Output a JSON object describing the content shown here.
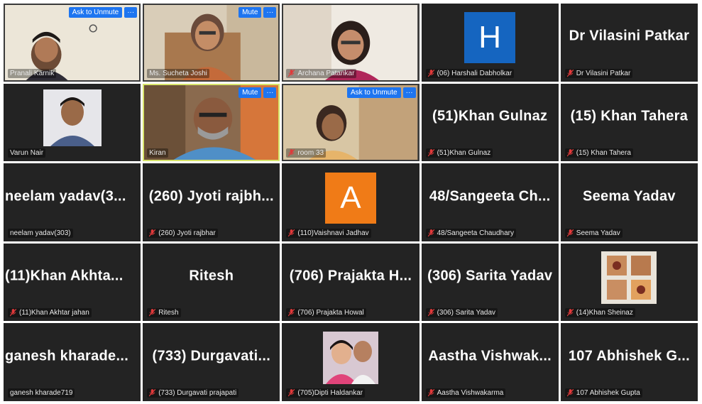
{
  "colors": {
    "tile_bg": "#232323",
    "button_blue": "#1e75f0",
    "active_border": "#d7e46a",
    "muted_red": "#e0393a",
    "avatar_H": "#1565c0",
    "avatar_A": "#f07b17"
  },
  "tiles": [
    {
      "label": "Pranali Karnik",
      "button": "Ask to Unmute",
      "more": "···"
    },
    {
      "label": "Ms. Sucheta Joshi",
      "button": "Mute",
      "more": "···"
    },
    {
      "label": "Archana Patankar"
    },
    {
      "label": "(06) Harshali Dabholkar",
      "avatar_letter": "H"
    },
    {
      "title": "Dr Vilasini Patkar",
      "label": "Dr Vilasini Patkar"
    },
    {
      "label": "Varun Nair"
    },
    {
      "label": "Kiran",
      "button": "Mute",
      "more": "···"
    },
    {
      "label": "room 33",
      "button": "Ask to Unmute",
      "more": "···"
    },
    {
      "title": "(51)Khan Gulnaz",
      "label": "(51)Khan Gulnaz"
    },
    {
      "title": "(15) Khan Tahera",
      "label": "(15) Khan Tahera"
    },
    {
      "title": "neelam yadav(3...",
      "label": "neelam yadav(303)"
    },
    {
      "title": "(260) Jyoti rajbh...",
      "label": "(260) Jyoti rajbhar"
    },
    {
      "label": "(110)Vaishnavi Jadhav",
      "avatar_letter": "A"
    },
    {
      "title": "48/Sangeeta Ch...",
      "label": "48/Sangeeta Chaudhary"
    },
    {
      "title": "Seema Yadav",
      "label": "Seema Yadav"
    },
    {
      "title": "(11)Khan Akhta...",
      "label": "(11)Khan Akhtar jahan"
    },
    {
      "title": "Ritesh",
      "label": "Ritesh"
    },
    {
      "title": "(706) Prajakta H...",
      "label": "(706) Prajakta Howal"
    },
    {
      "title": "(306) Sarita Yadav",
      "label": "(306) Sarita Yadav"
    },
    {
      "label": "(14)Khan Sheinaz"
    },
    {
      "title": "ganesh kharade...",
      "label": "ganesh kharade719"
    },
    {
      "title": "(733) Durgavati...",
      "label": "(733) Durgavati prajapati"
    },
    {
      "label": "(705)Dipti Haldankar"
    },
    {
      "title": "Aastha Vishwak...",
      "label": "Aastha Vishwakarma"
    },
    {
      "title": "107 Abhishek G...",
      "label": "107 Abhishek Gupta"
    }
  ]
}
